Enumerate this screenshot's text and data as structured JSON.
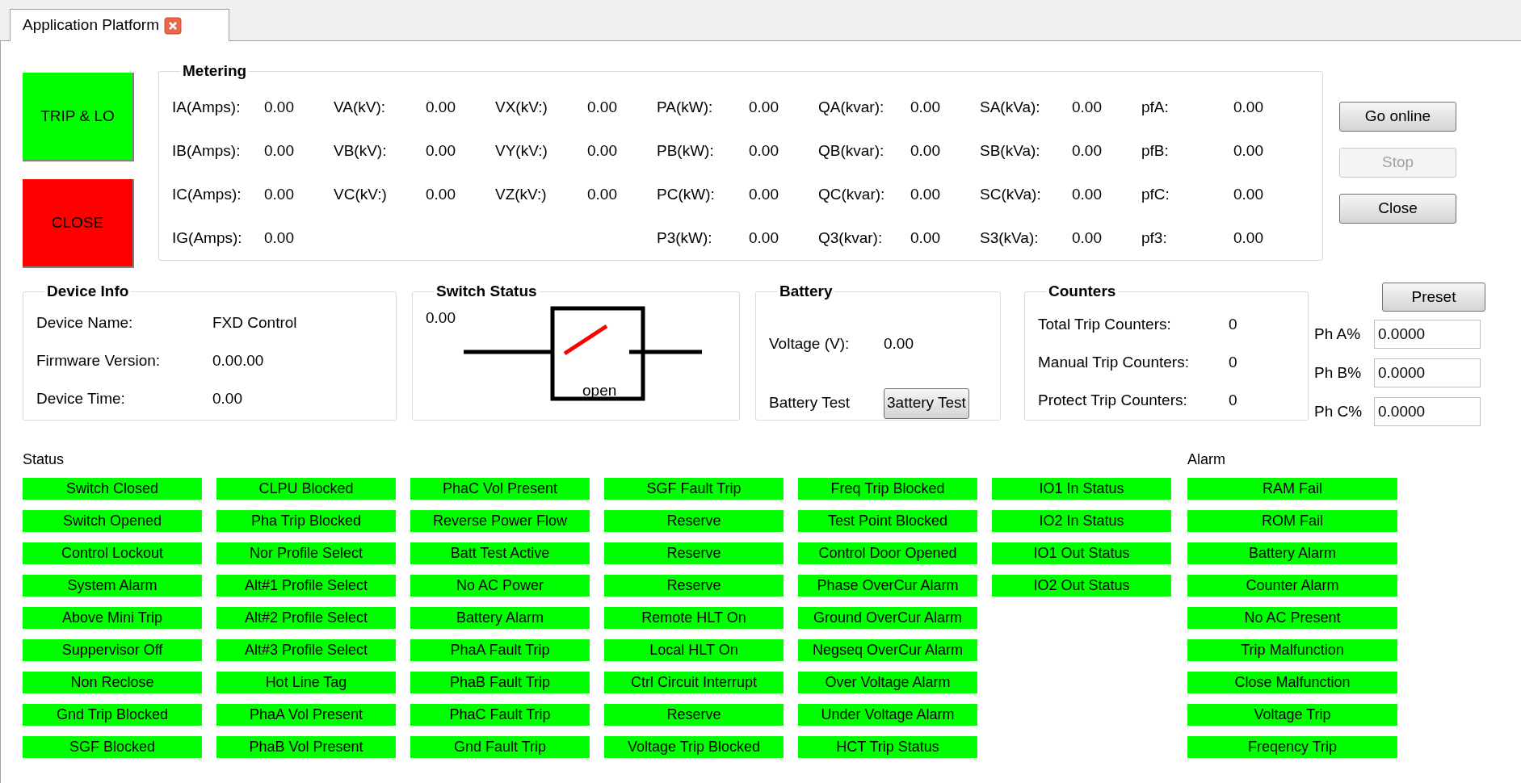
{
  "tab": {
    "label": "Application Platform",
    "closable": true
  },
  "action_buttons": [
    {
      "label": "TRIP & LO",
      "kind": "green"
    },
    {
      "label": "CLOSE",
      "kind": "red"
    }
  ],
  "metering": {
    "title": "Metering",
    "columns": [
      {
        "items": [
          {
            "label": "IA(Amps):",
            "value": "0.00"
          },
          {
            "label": "IB(Amps):",
            "value": "0.00"
          },
          {
            "label": "IC(Amps):",
            "value": "0.00"
          },
          {
            "label": "IG(Amps):",
            "value": "0.00"
          }
        ]
      },
      {
        "items": [
          {
            "label": "VA(kV):",
            "value": "0.00"
          },
          {
            "label": "VB(kV):",
            "value": "0.00"
          },
          {
            "label": "VC(kV:)",
            "value": "0.00"
          }
        ]
      },
      {
        "items": [
          {
            "label": "VX(kV:)",
            "value": "0.00"
          },
          {
            "label": "VY(kV:)",
            "value": "0.00"
          },
          {
            "label": "VZ(kV:)",
            "value": "0.00"
          }
        ]
      },
      {
        "items": [
          {
            "label": "PA(kW):",
            "value": "0.00"
          },
          {
            "label": "PB(kW):",
            "value": "0.00"
          },
          {
            "label": "PC(kW):",
            "value": "0.00"
          },
          {
            "label": "P3(kW):",
            "value": "0.00"
          }
        ]
      },
      {
        "items": [
          {
            "label": "QA(kvar):",
            "value": "0.00"
          },
          {
            "label": "QB(kvar):",
            "value": "0.00"
          },
          {
            "label": "QC(kvar):",
            "value": "0.00"
          },
          {
            "label": "Q3(kvar):",
            "value": "0.00"
          }
        ]
      },
      {
        "items": [
          {
            "label": "SA(kVa):",
            "value": "0.00"
          },
          {
            "label": "SB(kVa):",
            "value": "0.00"
          },
          {
            "label": "SC(kVa):",
            "value": "0.00"
          },
          {
            "label": "S3(kVa):",
            "value": "0.00"
          }
        ]
      },
      {
        "items": [
          {
            "label": "pfA:",
            "value": "0.00"
          },
          {
            "label": "pfB:",
            "value": "0.00"
          },
          {
            "label": "pfC:",
            "value": "0.00"
          },
          {
            "label": "pf3:",
            "value": "0.00"
          }
        ]
      }
    ]
  },
  "side_buttons": [
    {
      "label": "Go online",
      "disabled": false
    },
    {
      "label": "Stop",
      "disabled": true
    },
    {
      "label": "Close",
      "disabled": false
    }
  ],
  "device_info": {
    "title": "Device Info",
    "rows": [
      {
        "label": "Device Name:",
        "value": "FXD Control"
      },
      {
        "label": "Firmware Version:",
        "value": "0.00.00"
      },
      {
        "label": "Device Time:",
        "value": "0.00"
      }
    ]
  },
  "switch_status": {
    "title": "Switch Status",
    "value": "0.00",
    "state": "open"
  },
  "battery": {
    "title": "Battery",
    "voltage_label": "Voltage (V):",
    "voltage": "0.00",
    "test_label": "Battery Test",
    "test_button": "3attery Test"
  },
  "counters": {
    "title": "Counters",
    "rows": [
      {
        "label": "Total Trip Counters:",
        "value": "0"
      },
      {
        "label": "Manual Trip Counters:",
        "value": "0"
      },
      {
        "label": "Protect Trip Counters:",
        "value": "0"
      }
    ]
  },
  "preset": {
    "button": "Preset",
    "fields": [
      {
        "label": "Ph A%",
        "value": "0.0000"
      },
      {
        "label": "Ph B%",
        "value": "0.0000"
      },
      {
        "label": "Ph C%",
        "value": "0.0000"
      }
    ]
  },
  "status": {
    "title": "Status",
    "columns": [
      [
        "Switch Closed",
        "Switch Opened",
        "Control Lockout",
        "System Alarm",
        "Above Mini Trip",
        "Suppervisor Off",
        "Non Reclose",
        "Gnd Trip Blocked",
        "SGF Blocked"
      ],
      [
        "CLPU Blocked",
        "Pha Trip Blocked",
        "Nor Profile Select",
        "Alt#1 Profile Select",
        "Alt#2 Profile Select",
        "Alt#3 Profile Select",
        "Hot Line Tag",
        "PhaA Vol Present",
        "PhaB Vol Present"
      ],
      [
        "PhaC Vol Present",
        "Reverse Power Flow",
        "Batt Test Active",
        "No AC Power",
        "Battery Alarm",
        "PhaA Fault Trip",
        "PhaB Fault Trip",
        "PhaC Fault Trip",
        "Gnd Fault Trip"
      ],
      [
        "SGF Fault Trip",
        "Reserve",
        "Reserve",
        "Reserve",
        "Remote HLT On",
        "Local HLT On",
        "Ctrl Circuit Interrupt",
        "Reserve",
        "Voltage Trip Blocked"
      ],
      [
        "Freq Trip Blocked",
        "Test Point Blocked",
        "Control Door Opened",
        "Phase OverCur Alarm",
        "Ground OverCur Alarm",
        "Negseq OverCur Alarm",
        "Over Voltage Alarm",
        "Under Voltage Alarm",
        "HCT Trip Status"
      ],
      [
        "IO1 In Status",
        "IO2 In Status",
        "IO1 Out Status",
        "IO2 Out Status"
      ]
    ]
  },
  "alarm": {
    "title": "Alarm",
    "items": [
      "RAM Fail",
      "ROM Fail",
      "Battery Alarm",
      "Counter Alarm",
      "No AC Present",
      "Trip Malfunction",
      "Close Malfunction",
      "Voltage Trip",
      "Freqency Trip"
    ]
  }
}
